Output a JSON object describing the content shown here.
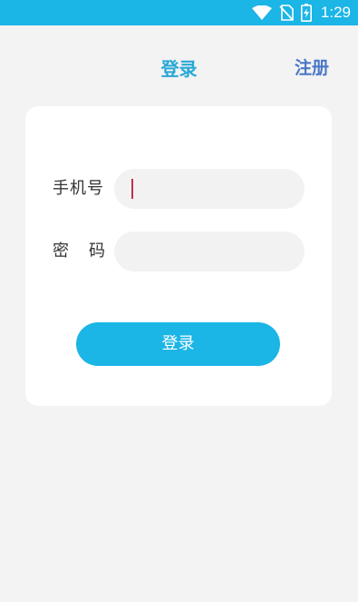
{
  "status_bar": {
    "time": "1:29",
    "icons": [
      "wifi-icon",
      "no-sim-icon",
      "battery-charging-icon"
    ],
    "color": "#1bb5e6"
  },
  "header": {
    "title": "登录",
    "register_label": "注册"
  },
  "form": {
    "phone_label": "手机号",
    "phone_value": "",
    "password_label": "密码",
    "password_value": ""
  },
  "login_button": {
    "label": "登录",
    "color": "#1bb5e6"
  }
}
